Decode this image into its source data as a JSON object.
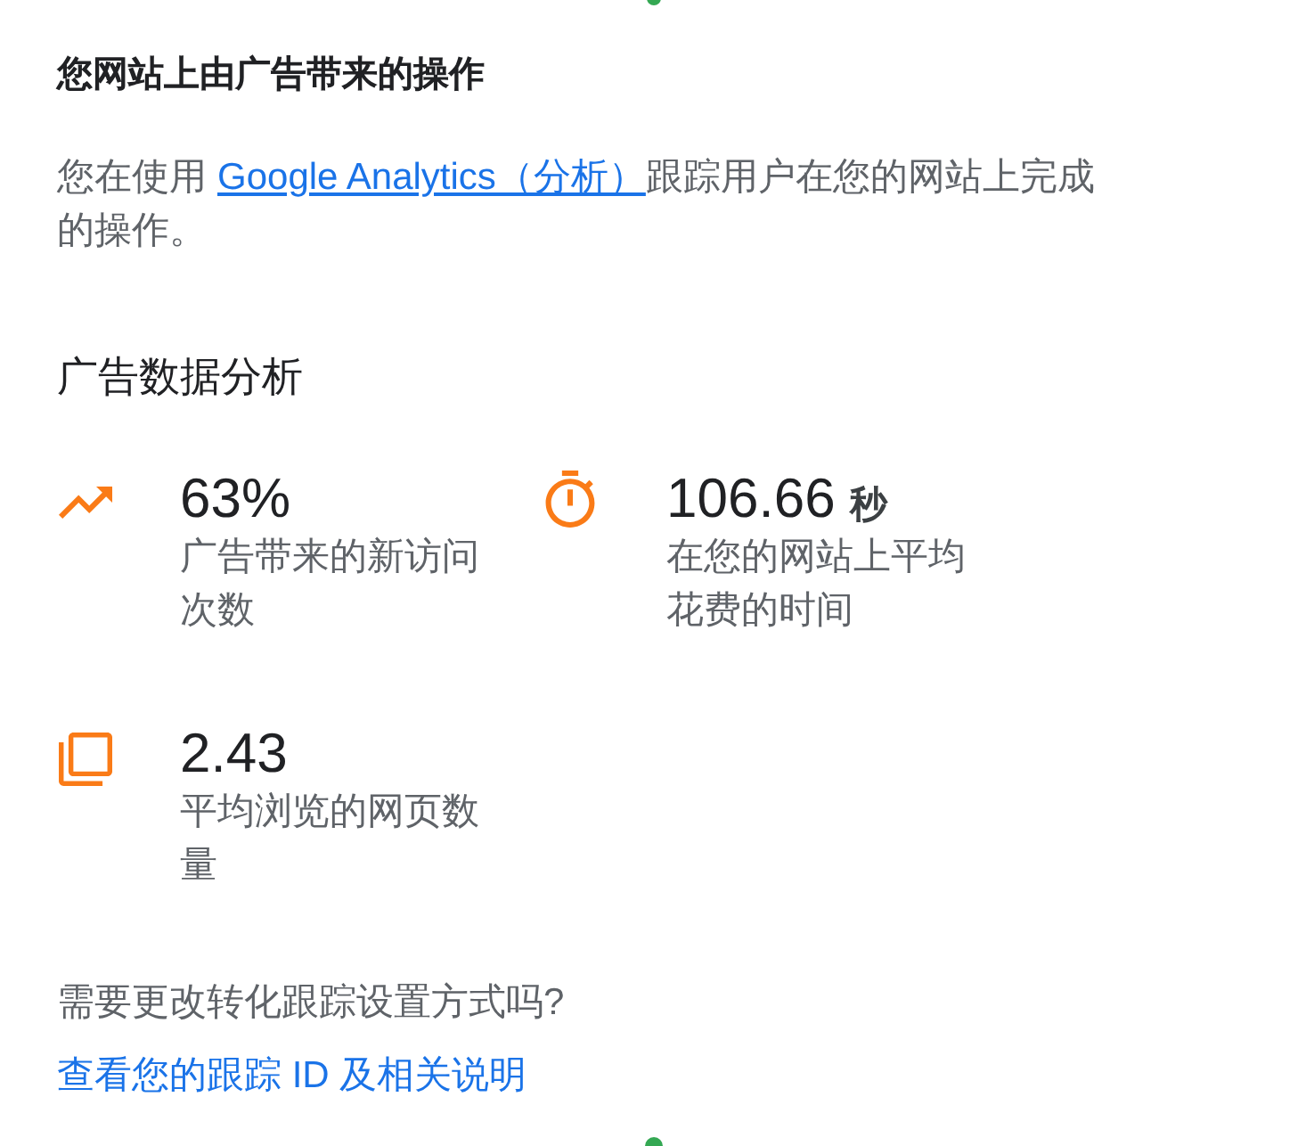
{
  "conversions_section": {
    "title": "您网站上由广告带来的操作",
    "description": {
      "text_before": "您在使用",
      "link": "Google Analytics（分析）",
      "text_after": "跟踪用户在您的网站上完成的操作。"
    }
  },
  "analytics_section": {
    "title": "广告数据分析",
    "metrics": [
      {
        "kind": "trend",
        "value": "63%",
        "label": "广告带来的新访问次数"
      },
      {
        "kind": "timer",
        "value": "106.66",
        "unit": "秒",
        "label": "在您的网站上平均花费的时间"
      },
      {
        "kind": "pages",
        "value": "2.43",
        "label": "平均浏览的网页数量"
      }
    ]
  },
  "footer": {
    "question": "需要更改转化跟踪设置方式吗?",
    "link": "查看您的跟踪 ID 及相关说明"
  }
}
